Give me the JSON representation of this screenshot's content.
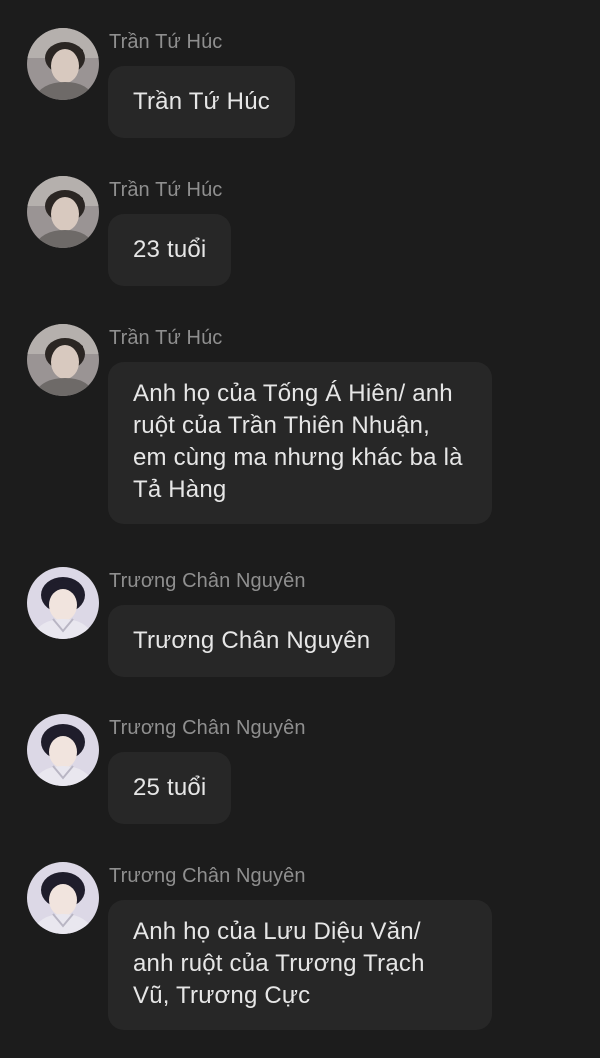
{
  "messages": [
    {
      "sender": "Trần Tứ Húc",
      "text": "Trần Tứ Húc",
      "avatar_icon": "person-photo-avatar"
    },
    {
      "sender": "Trần Tứ Húc",
      "text": "23 tuổi",
      "avatar_icon": "person-photo-avatar"
    },
    {
      "sender": "Trần Tứ Húc",
      "text": "Anh họ của Tống Á Hiên/ anh ruột của Trần Thiên Nhuận, em cùng ma nhưng khác ba là Tả Hàng",
      "avatar_icon": "person-photo-avatar"
    },
    {
      "sender": "Trương Chân Nguyên",
      "text": "Trương Chân Nguyên",
      "avatar_icon": "person-photo-avatar"
    },
    {
      "sender": "Trương Chân Nguyên",
      "text": "25 tuổi",
      "avatar_icon": "person-photo-avatar"
    },
    {
      "sender": "Trương Chân Nguyên",
      "text": "Anh họ của Lưu Diệu Văn/ anh ruột của Trương Trạch Vũ, Trương Cực",
      "avatar_icon": "person-photo-avatar"
    }
  ],
  "colors": {
    "background": "#1c1c1c",
    "bubble": "#272727",
    "sender_text": "#8f8f8f",
    "message_text": "#e6e6e6"
  }
}
